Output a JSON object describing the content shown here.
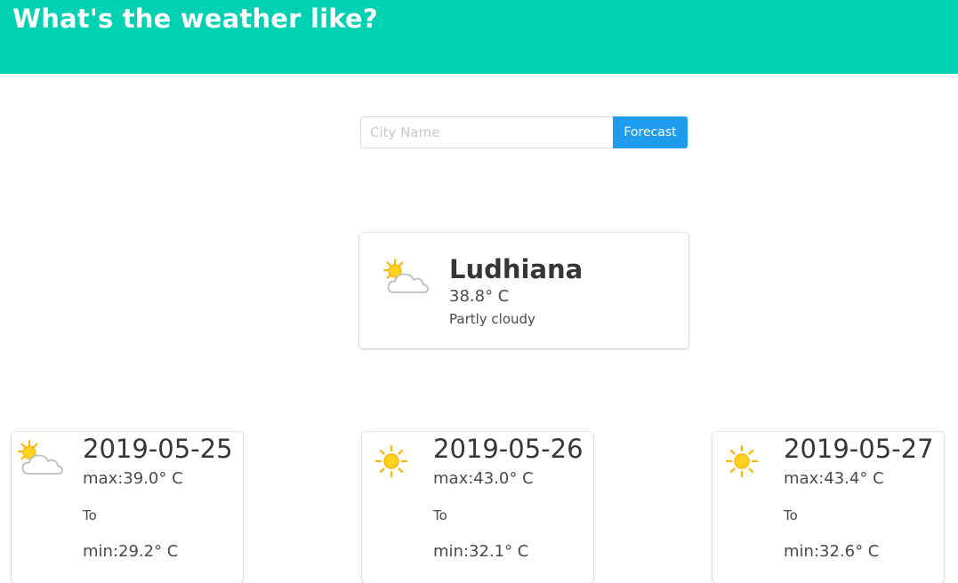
{
  "header": {
    "title": "What's the weather like?"
  },
  "search": {
    "placeholder": "City Name",
    "value": "",
    "button_label": "Forecast"
  },
  "current": {
    "city": "Ludhiana",
    "temperature": "38.8° C",
    "description": "Partly cloudy",
    "icon": "partly-cloudy-icon"
  },
  "forecast": [
    {
      "date": "2019-05-25",
      "max": "max:39.0° C",
      "to": "To",
      "min": "min:29.2° C",
      "icon": "partly-cloudy-icon"
    },
    {
      "date": "2019-05-26",
      "max": "max:43.0° C",
      "to": "To",
      "min": "min:32.1° C",
      "icon": "sun-icon"
    },
    {
      "date": "2019-05-27",
      "max": "max:43.4° C",
      "to": "To",
      "min": "min:32.6° C",
      "icon": "sun-icon"
    }
  ],
  "colors": {
    "header": "#00d1b2",
    "button": "#209cee",
    "sun": "#ffc400"
  }
}
